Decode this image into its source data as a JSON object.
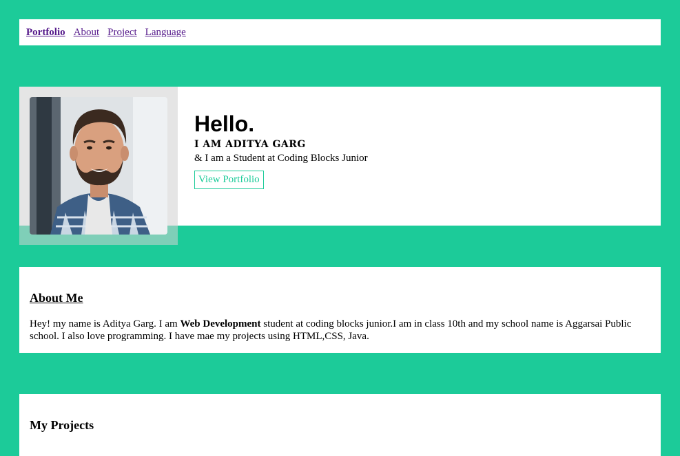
{
  "nav": {
    "brand": "Portfolio",
    "links": [
      "About",
      "Project",
      "Language"
    ]
  },
  "hero": {
    "greeting": "Hello.",
    "name_line": "I AM ADITYA GARG",
    "tagline": "& I am a Student at Coding Blocks Junior",
    "button": "View Portfolio"
  },
  "about": {
    "title": "About Me",
    "text_before": "Hey! my name is Aditya Garg. I am ",
    "text_bold": "Web Development",
    "text_after": " student at coding blocks junior.I am in class 10th and my school name is Aggarsai Public school. I also love programming. I have mae my projects using HTML,CSS, Java."
  },
  "projects": {
    "title": "My Projects"
  },
  "colors": {
    "background": "#1ccb99",
    "link": "#551a8b",
    "accent": "#1ccb99"
  },
  "icons": {
    "avatar": "profile-photo"
  }
}
